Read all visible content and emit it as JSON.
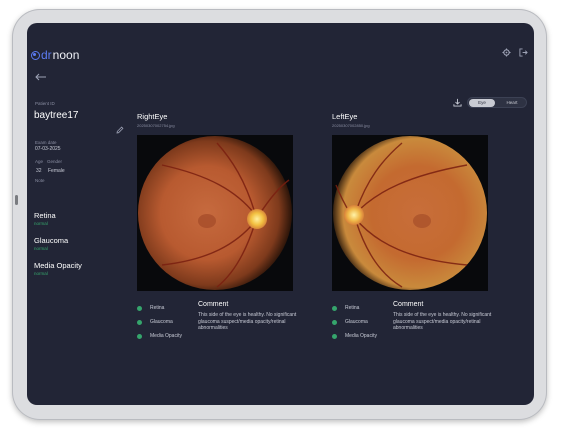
{
  "app": {
    "brand_prefix": "dr",
    "brand_suffix": "noon",
    "brand_color": "#5c7bf2",
    "accent_status_color": "#35a56c",
    "background": "#222536"
  },
  "top_icons": [
    "gear-icon",
    "logout-icon"
  ],
  "sidebar": {
    "patient_id_label": "Patient ID",
    "patient_id": "baytree17",
    "exam_date_label": "Exam date",
    "exam_date": "07-03-2025",
    "age_label": "Age",
    "age": "32",
    "gender_label": "Gender",
    "gender": "Female",
    "note_label": "Note",
    "conditions": [
      {
        "title": "Retina",
        "status": "normal"
      },
      {
        "title": "Glaucoma",
        "status": "normal"
      },
      {
        "title": "Media Opacity",
        "status": "normal"
      }
    ]
  },
  "toggle": {
    "eye_label": "Eye",
    "heart_label": "Heart",
    "selected": "Eye"
  },
  "right_eye": {
    "title": "RightEye",
    "filename": "20250307002754.jpg",
    "legend": [
      "Retina",
      "Glaucoma",
      "Media Opacity"
    ],
    "comment_title": "Comment",
    "comment_text": "This side of the eye is healthy. No significant glaucoma suspect/media opacity/retinal abnormalities"
  },
  "left_eye": {
    "title": "LeftEye",
    "filename": "20250307002850.jpg",
    "legend": [
      "Retina",
      "Glaucoma",
      "Media Opacity"
    ],
    "comment_title": "Comment",
    "comment_text": "This side of the eye is healthy. No significant glaucoma suspect/media opacity/retinal abnormalities"
  }
}
